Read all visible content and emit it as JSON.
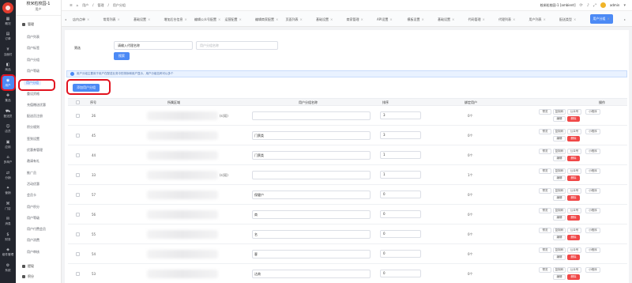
{
  "rail": {
    "items": [
      {
        "label": "概况",
        "icon": "grid-icon"
      },
      {
        "label": "订单",
        "icon": "order-icon"
      },
      {
        "label": "当面付",
        "icon": "pay-icon"
      },
      {
        "label": "商品",
        "icon": "goods-icon"
      },
      {
        "label": "用户",
        "icon": "user-icon",
        "active": true
      },
      {
        "label": "集品",
        "icon": "collect-icon"
      },
      {
        "label": "配送员",
        "icon": "courier-icon"
      },
      {
        "label": "店员",
        "icon": "staff-icon"
      },
      {
        "label": "应用",
        "icon": "app-icon"
      },
      {
        "label": "多商户",
        "icon": "store-icon"
      },
      {
        "label": "分销",
        "icon": "share-icon"
      },
      {
        "label": "营销",
        "icon": "market-icon"
      },
      {
        "label": "门店",
        "icon": "shop-icon"
      },
      {
        "label": "消息",
        "icon": "message-icon"
      },
      {
        "label": "财务",
        "icon": "finance-icon"
      },
      {
        "label": "组件管理",
        "icon": "module-icon"
      },
      {
        "label": "系统",
        "icon": "system-icon"
      }
    ]
  },
  "submenu": {
    "title": "校米粒校园-1",
    "subtitle": "用户",
    "group_label": "管理",
    "items": [
      "用户列表",
      "用户标签",
      "用户分组",
      "用户等级",
      "用户分组",
      "重设资格",
      "充值赠送优惠",
      "配送员注册",
      "积分规则",
      "签到设置",
      "优惠券管理",
      "邀请有礼",
      "推广员",
      "活动优惠",
      "会员卡",
      "用户积分",
      "用户等级",
      "用户付费会员",
      "用户消费",
      "用户审核"
    ],
    "active_index": 4,
    "bottom_groups": [
      "提现",
      "积分"
    ]
  },
  "topbar": {
    "breadcrumb": [
      "用户",
      "管理",
      "用户分组"
    ],
    "store_name": "校米粒校园-1 [ambient]",
    "user": "admin"
  },
  "tabs": [
    {
      "label": "店内点单"
    },
    {
      "label": "常用列表"
    },
    {
      "label": "基础设置"
    },
    {
      "label": "增加后台信息"
    },
    {
      "label": "编辑公众号配置"
    },
    {
      "label": "运营配置"
    },
    {
      "label": "编辑商家配置"
    },
    {
      "label": "页面列表"
    },
    {
      "label": "基础设置"
    },
    {
      "label": "商家管理"
    },
    {
      "label": "API设置"
    },
    {
      "label": "模板设置"
    },
    {
      "label": "基础设置"
    },
    {
      "label": "代码管理"
    },
    {
      "label": "代理列表"
    },
    {
      "label": "用户列表"
    },
    {
      "label": "配送类型"
    },
    {
      "label": "用户分组",
      "active": true
    }
  ],
  "filter": {
    "label": "筛选",
    "name_value": "请输入代理名称",
    "group_placeholder": "用户分组名称",
    "search_label": "搜索"
  },
  "info_text": "用户分组主要用于用户在配送业务中的排序和用户显示，用户分组名称可以多个",
  "add_button": "添加用户分组",
  "table": {
    "headers": [
      "序号",
      "所属区域",
      "用户分组名称",
      "排序",
      "绑定用户",
      "操作"
    ],
    "actions": [
      "预览",
      "复制码",
      "公众号",
      "小程序",
      "编辑",
      "删除"
    ],
    "rows": [
      {
        "id": "26",
        "region": "(s(双)",
        "name": "",
        "order": "3",
        "bound": "0个"
      },
      {
        "id": "45",
        "region": "",
        "name": "门票类",
        "order": "3",
        "bound": "0个"
      },
      {
        "id": "44",
        "region": "",
        "name": "门票类",
        "order": "1",
        "bound": "0个"
      },
      {
        "id": "33",
        "region": "(s(双)",
        "name": "",
        "order": "1",
        "bound": "1个"
      },
      {
        "id": "57",
        "region": "",
        "name": "保健户",
        "order": "0",
        "bound": "0个"
      },
      {
        "id": "56",
        "region": "",
        "name": "商",
        "order": "0",
        "bound": "0个"
      },
      {
        "id": "55",
        "region": "",
        "name": "名",
        "order": "0",
        "bound": "0个"
      },
      {
        "id": "54",
        "region": "",
        "name": "客",
        "order": "0",
        "bound": "0个"
      },
      {
        "id": "53",
        "region": "",
        "name": "达商",
        "order": "0",
        "bound": "0个"
      }
    ]
  },
  "colors": {
    "accent": "#4c8af5",
    "danger": "#f04747",
    "rail_bg": "#23262e",
    "highlight_ring": "#e2121e"
  }
}
